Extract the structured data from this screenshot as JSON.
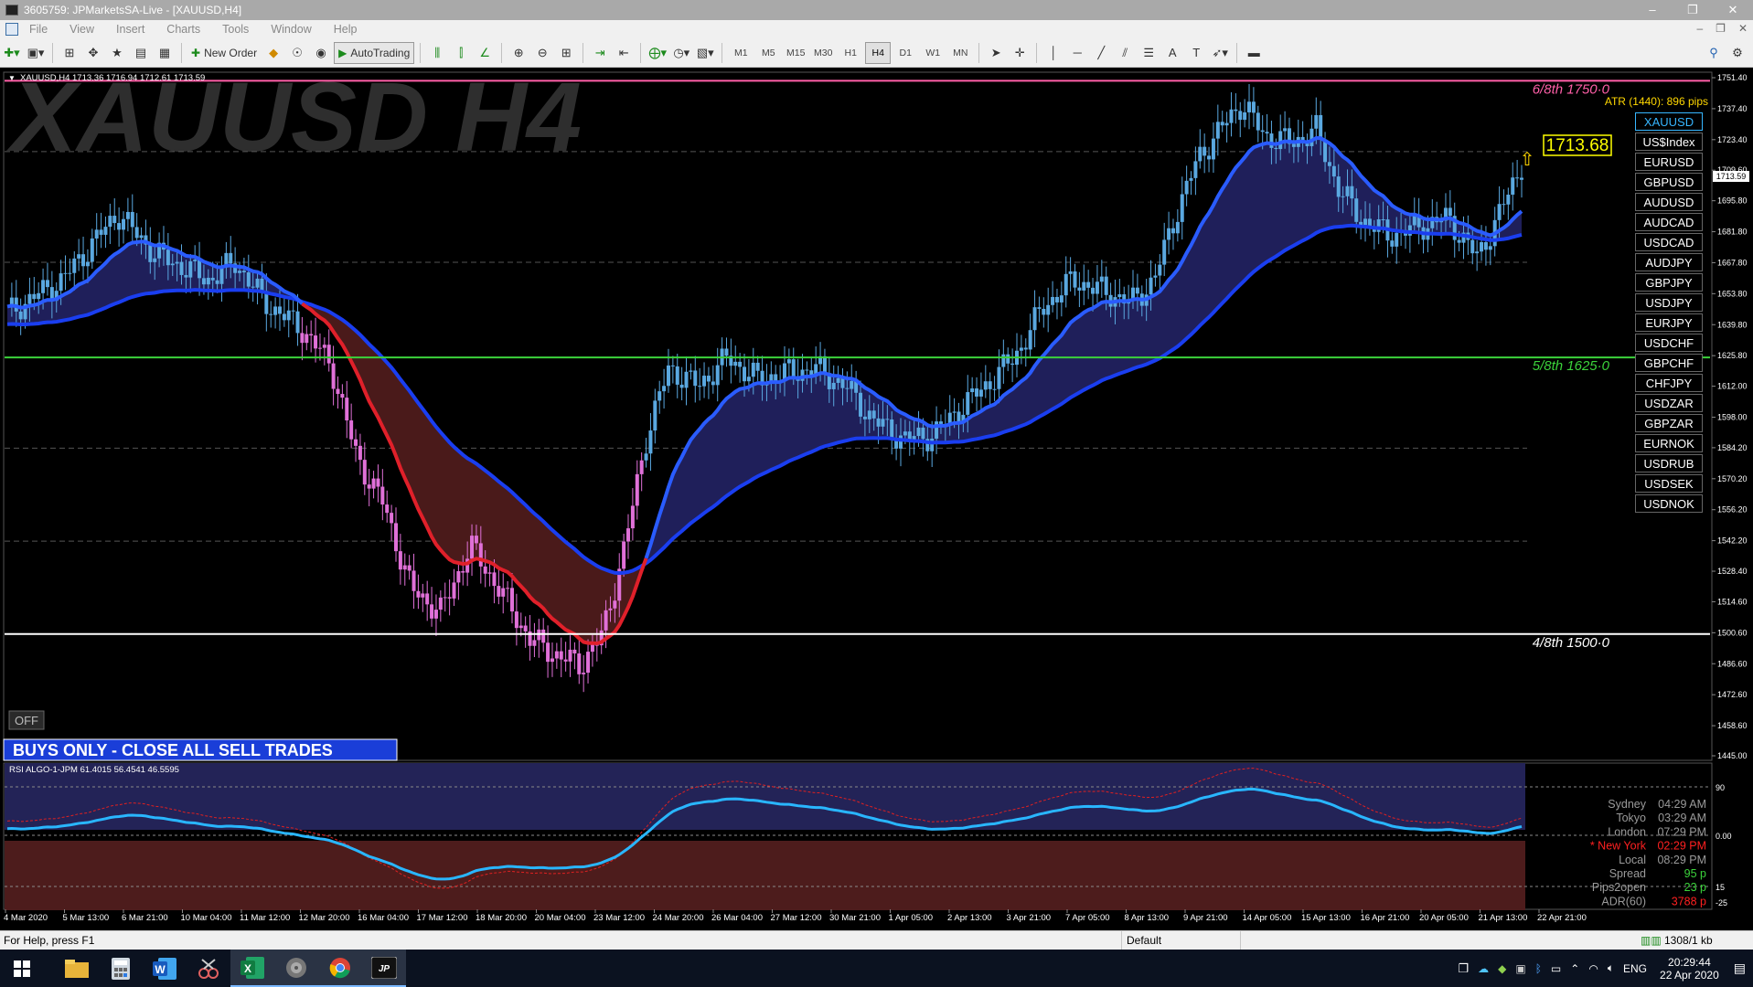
{
  "window": {
    "title": "3605759: JPMarketsSA-Live - [XAUUSD,H4]",
    "controls": [
      "–",
      "❐",
      "✕"
    ]
  },
  "menu": [
    "File",
    "View",
    "Insert",
    "Charts",
    "Tools",
    "Window",
    "Help"
  ],
  "toolbar": {
    "new_order": "New Order",
    "autotrading": "AutoTrading",
    "timeframes": [
      "M1",
      "M5",
      "M15",
      "M30",
      "H1",
      "H4",
      "D1",
      "W1",
      "MN"
    ],
    "active_timeframe": "H4"
  },
  "chart": {
    "info_line": "XAUUSD,H4  1713.36 1716.94 1712.61 1713.59",
    "watermark": "XAUUSD H4",
    "atr": "ATR (1440): 896 pips",
    "current_price": "1713.68",
    "price_tag": "1713.59",
    "banner": "BUYS ONLY - CLOSE ALL SELL TRADES",
    "off_button": "OFF",
    "murrey_levels": [
      {
        "label": "6/8th  1750·0",
        "price": 1750,
        "color": "#ff5fa8"
      },
      {
        "label": "5/8th  1625·0",
        "price": 1625,
        "color": "#3bd23b"
      },
      {
        "label": "4/8th  1500·0",
        "price": 1500,
        "color": "#ffffff"
      }
    ],
    "price_axis": [
      "1751.40",
      "1737.40",
      "1723.40",
      "1709.60",
      "1695.80",
      "1681.80",
      "1667.80",
      "1653.80",
      "1639.80",
      "1625.80",
      "1612.00",
      "1598.00",
      "1584.20",
      "1570.20",
      "1556.20",
      "1542.20",
      "1528.40",
      "1514.60",
      "1500.60",
      "1486.60",
      "1472.60",
      "1458.60",
      "1445.00"
    ],
    "symbols": [
      "XAUUSD",
      "US$Index",
      "EURUSD",
      "GBPUSD",
      "AUDUSD",
      "AUDCAD",
      "USDCAD",
      "AUDJPY",
      "GBPJPY",
      "USDJPY",
      "EURJPY",
      "USDCHF",
      "GBPCHF",
      "CHFJPY",
      "USDZAR",
      "GBPZAR",
      "EURNOK",
      "USDRUB",
      "USDSEK",
      "USDNOK"
    ],
    "active_symbol": "XAUUSD"
  },
  "rsi": {
    "label": "RSI  ALGO-1-JPM   61.4015 56.4541 46.5595",
    "axis": [
      "90",
      "0.00",
      "15",
      "-25"
    ]
  },
  "sessions": [
    {
      "name": "Sydney",
      "time": "04:29 AM",
      "color": "#9a9a9a"
    },
    {
      "name": "Tokyo",
      "time": "03:29 AM",
      "color": "#9a9a9a"
    },
    {
      "name": "London",
      "time": "07:29 PM",
      "color": "#9a9a9a"
    },
    {
      "name": "* New York",
      "time": "02:29 PM",
      "color": "#ff2020"
    },
    {
      "name": "Local",
      "time": "08:29 PM",
      "color": "#9a9a9a"
    },
    {
      "name": "Spread",
      "time": "95 p",
      "color": "#9a9a9a",
      "valcolor": "#3bd23b"
    },
    {
      "name": "Pips2open",
      "time": "23 p",
      "color": "#9a9a9a",
      "valcolor": "#3bd23b"
    },
    {
      "name": "ADR(60)",
      "time": "3788 p",
      "color": "#9a9a9a",
      "valcolor": "#ff2020"
    }
  ],
  "time_axis": [
    "4 Mar 2020",
    "5 Mar 13:00",
    "6 Mar 21:00",
    "10 Mar 04:00",
    "11 Mar 12:00",
    "12 Mar 20:00",
    "16 Mar 04:00",
    "17 Mar 12:00",
    "18 Mar 20:00",
    "20 Mar 04:00",
    "23 Mar 12:00",
    "24 Mar 20:00",
    "26 Mar 04:00",
    "27 Mar 12:00",
    "30 Mar 21:00",
    "1 Apr 05:00",
    "2 Apr 13:00",
    "3 Apr 21:00",
    "7 Apr 05:00",
    "8 Apr 13:00",
    "9 Apr 21:00",
    "14 Apr 05:00",
    "15 Apr 13:00",
    "16 Apr 21:00",
    "20 Apr 05:00",
    "21 Apr 13:00",
    "22 Apr 21:00"
  ],
  "status": {
    "help": "For Help, press F1",
    "profile": "Default",
    "traffic": "1308/1 kb"
  },
  "taskbar": {
    "lang": "ENG",
    "time": "20:29:44",
    "date": "22 Apr 2020"
  }
}
